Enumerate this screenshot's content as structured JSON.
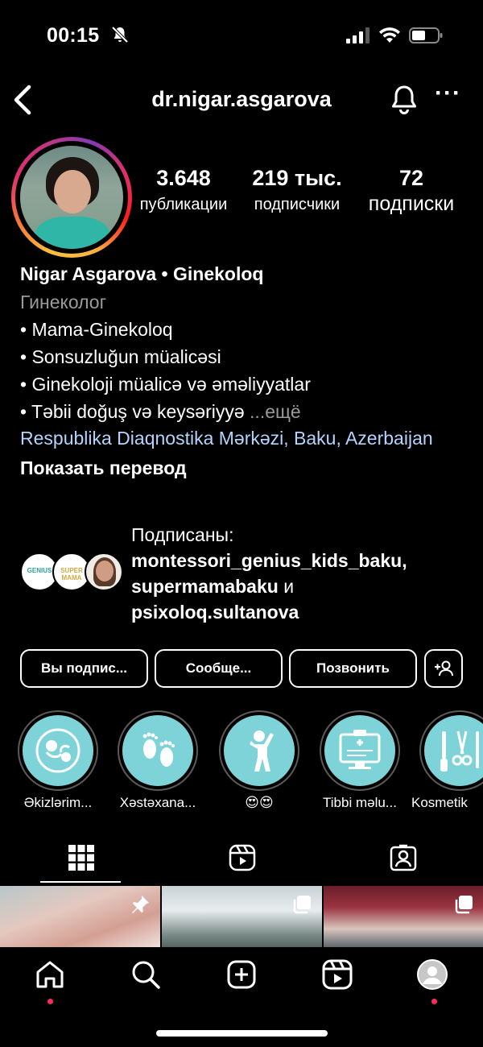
{
  "status_bar": {
    "time": "00:15"
  },
  "header": {
    "username": "dr.nigar.asgarova"
  },
  "stats": {
    "posts_count": "3.648",
    "posts_label": "публикации",
    "followers_count": "219 тыс.",
    "followers_label": "подписчики",
    "following_count": "72",
    "following_label": "подписки"
  },
  "bio": {
    "name": "Nigar Asgarova • Ginekoloq",
    "category": "Гинеколог",
    "lines": [
      "• Mama-Ginekoloq",
      "• Sonsuzluğun müalicəsi",
      "• Ginekoloji müalicə və əməliyyatlar",
      "• Təbii doğuş və keysəriyyə"
    ],
    "more": "...ещё",
    "location": "Respublika Diaqnostika Mərkəzi, Baku, Azerbaijan",
    "translate": "Показать перевод"
  },
  "followed_by": {
    "prefix": "Подписаны:",
    "user1": "montessori_genius_kids_baku",
    "sep": ", ",
    "user2": "supermamabaku",
    "and": " и ",
    "user3": "psixoloq.sultanova",
    "avatar1_text": "GENIUS",
    "avatar2_text": "SUPER MAMA"
  },
  "actions": {
    "following": "Вы подпис...",
    "message": "Сообще...",
    "call": "Позвонить"
  },
  "highlights": [
    {
      "label": "Əkizlərim...",
      "icon": "twins-icon"
    },
    {
      "label": "Xəstəxana...",
      "icon": "baby-feet-icon"
    },
    {
      "label": "😍😍",
      "icon": "child-silhouette-icon"
    },
    {
      "label": "Tibbi məlu...",
      "icon": "medical-monitor-icon"
    },
    {
      "label": "Kosmetik",
      "icon": "surgical-tools-icon"
    }
  ],
  "tabs": [
    "grid-icon",
    "reels-icon",
    "tagged-icon"
  ],
  "bottom_nav": [
    "home-icon",
    "search-icon",
    "create-icon",
    "reels-icon",
    "profile-icon"
  ],
  "colors": {
    "background": "#000000",
    "link": "#b3d4fc",
    "secondary_text": "#9a9a9a",
    "highlight_fill": "#7ed3d9",
    "notification_dot": "#ff2d55"
  }
}
